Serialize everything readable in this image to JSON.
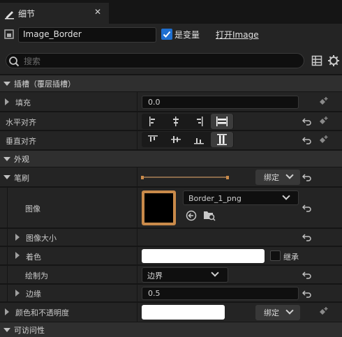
{
  "tab": {
    "label": "细节",
    "close": "✕"
  },
  "header": {
    "widget_name": "Image_Border",
    "is_variable_label": "是变量",
    "is_variable_checked": true,
    "open_link": "打开Image"
  },
  "search": {
    "placeholder": "搜索"
  },
  "sections": {
    "slot": {
      "title": "插槽（覆层插槽）",
      "padding_label": "填充",
      "padding_value": "0.0",
      "halign_label": "水平对齐",
      "valign_label": "垂直对齐"
    },
    "appearance": {
      "title": "外观",
      "brush_label": "笔刷",
      "bind_label": "绑定",
      "image_label": "图像",
      "image_asset": "Border_1_png",
      "image_size_label": "图像大小",
      "tint_label": "着色",
      "inherit_label": "继承",
      "draw_as_label": "绘制为",
      "draw_as_value": "边界",
      "margin_label": "边缘",
      "margin_value": "0.5",
      "color_opacity_label": "颜色和不透明度",
      "color_bind_label": "绑定"
    },
    "accessibility": {
      "title": "可访问性"
    }
  },
  "colors": {
    "accent_blue": "#1e6fd0",
    "thumbnail_border": "#c98a4a",
    "background": "#242424",
    "category": "#2f2f2f"
  }
}
